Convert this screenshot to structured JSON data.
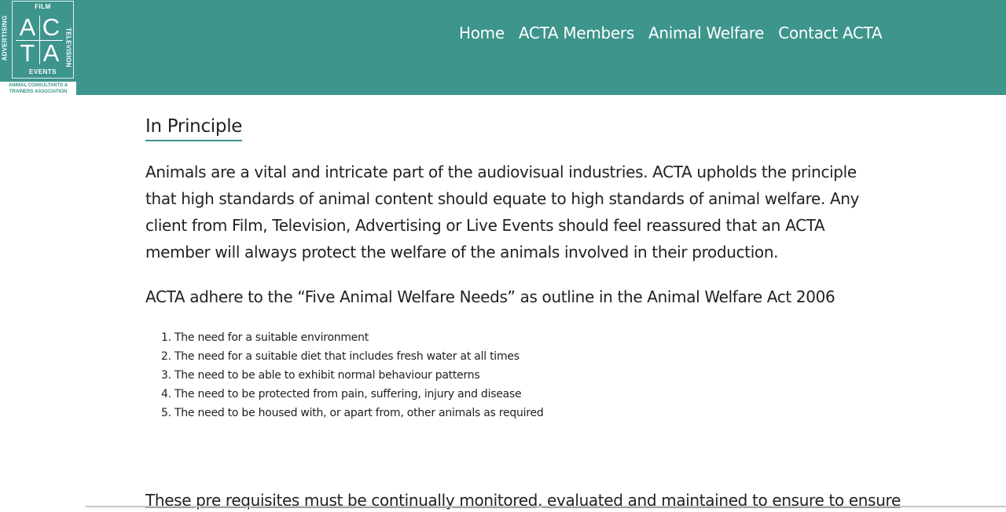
{
  "logo": {
    "film": "FILM",
    "advertising": "ADVERTISING",
    "television": "TELEVISION",
    "events": "EVENTS",
    "letters": [
      "A",
      "C",
      "T",
      "A"
    ],
    "assoc_line1": "ANIMAL CONSULTANTS &",
    "assoc_line2": "TRAINERS ASSOCIATION"
  },
  "nav": {
    "items": [
      {
        "label": "Home"
      },
      {
        "label": "ACTA Members"
      },
      {
        "label": "Animal Welfare"
      },
      {
        "label": "Contact ACTA"
      }
    ]
  },
  "content": {
    "title": "In Principle",
    "intro": "Animals are a vital and intricate part of the audiovisual industries. ACTA upholds the principle that high standards of animal content should equate to high standards of animal welfare. Any client from Film, Television, Advertising or Live Events should feel reassured that an ACTA member will always protect the welfare of the animals involved in their production.",
    "act_line": "ACTA adhere to the “Five Animal Welfare Needs” as outline in the Animal Welfare Act 2006",
    "needs": [
      "The need for a suitable environment",
      "The need for a suitable diet that includes fresh water at all times",
      "The need to be able to exhibit normal behaviour patterns",
      "The need to be protected from pain, suffering, injury and disease",
      "The need to be housed with, or apart from, other animals as required"
    ],
    "closing": "These pre requisites must be continually monitored, evaluated and maintained to ensure to ensure"
  },
  "colors": {
    "brand": "#3d958c",
    "text": "#222222"
  }
}
